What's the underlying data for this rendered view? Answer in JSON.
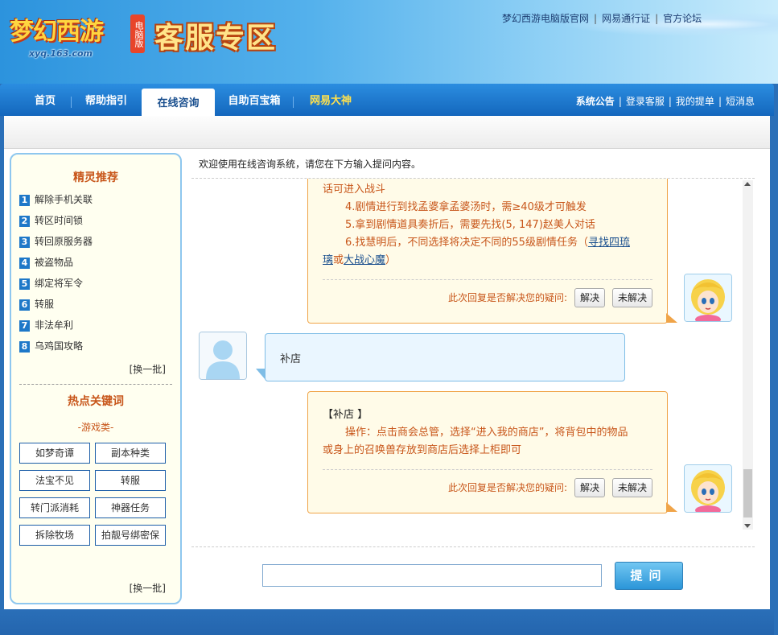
{
  "header": {
    "logo_text": "梦幻西游",
    "logo_badge": "电脑版",
    "logo_url": "xyq.163.com",
    "zone_title": "客服专区",
    "top_links": [
      "梦幻西游电脑版官网",
      "网易通行证",
      "官方论坛"
    ]
  },
  "nav": {
    "items": [
      {
        "label": "首页"
      },
      {
        "label": "帮助指引"
      },
      {
        "label": "在线咨询",
        "active": true
      },
      {
        "label": "自助百宝箱"
      },
      {
        "label": "网易大神",
        "highlight": true
      }
    ],
    "right_links": [
      "系统公告",
      "登录客服",
      "我的提单",
      "短消息"
    ]
  },
  "sidebar": {
    "recommend_title": "精灵推荐",
    "recommend_items": [
      {
        "num": "1",
        "label": "解除手机关联"
      },
      {
        "num": "2",
        "label": "转区时间锁"
      },
      {
        "num": "3",
        "label": "转回原服务器"
      },
      {
        "num": "4",
        "label": "被盗物品"
      },
      {
        "num": "5",
        "label": "绑定将军令"
      },
      {
        "num": "6",
        "label": "转服"
      },
      {
        "num": "7",
        "label": "非法牟利"
      },
      {
        "num": "8",
        "label": "乌鸡国攻略"
      }
    ],
    "batch_label": "[换一批]",
    "hot_title": "热点关键词",
    "game_category": "-游戏类-",
    "keywords": [
      "如梦奇谭",
      "副本种类",
      "法宝不见",
      "转服",
      "转门派消耗",
      "神器任务",
      "拆除牧场",
      "拍靓号绑密保"
    ],
    "batch_label_2": "[换一批]"
  },
  "chat": {
    "welcome": "欢迎使用在线咨询系统，请您在下方输入提问内容。",
    "reply1": {
      "line0": "话可进入战斗",
      "line1": "4.剧情进行到找孟婆拿孟婆汤时，需≥40级才可触发",
      "line2": "5.拿到剧情道具奏折后，需要先找(5, 147)赵美人对话",
      "line3_pre": "6.找慧明后，不同选择将决定不同的55级剧情任务（",
      "link1_a": "寻找四琉",
      "link1_b": "璃",
      "or": "或",
      "link2": "大战心魔",
      "close": "）",
      "feedback_q": "此次回复是否解决您的疑问:",
      "solved": "解决",
      "unsolved": "未解决"
    },
    "user_msg": "补店",
    "reply2": {
      "title": "【补店 】",
      "line1": "操作：点击商会总管，选择“进入我的商店”，将背包中的物品",
      "line2": "或身上的召唤兽存放到商店后选择上柜即可",
      "feedback_q": "此次回复是否解决您的疑问:",
      "solved": "解决",
      "unsolved": "未解决"
    }
  },
  "input": {
    "value": "",
    "placeholder": ""
  },
  "ask_button": "提问",
  "colors": {
    "nav_blue": "#1467bd",
    "reply_text": "#c8561a",
    "reply_border": "#f0a448",
    "user_bubble_border": "#7fbde6"
  }
}
